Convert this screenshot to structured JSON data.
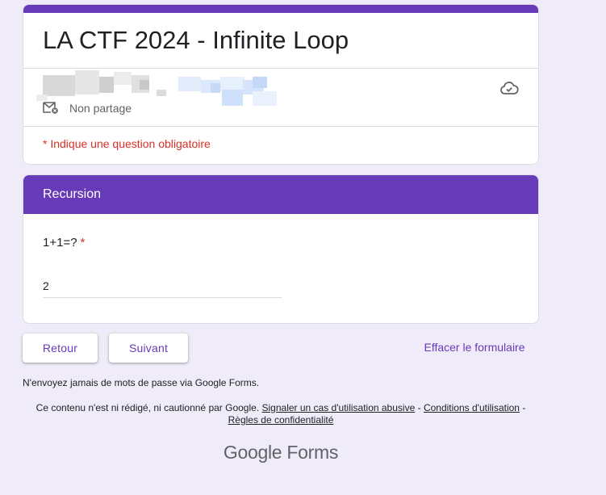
{
  "form": {
    "title": "LA CTF 2024 - Infinite Loop",
    "share_status": "Non partage",
    "required_note": "* Indique une question obligatoire"
  },
  "section": {
    "title": "Recursion",
    "question": {
      "label": "1+1=?",
      "required_mark": "*",
      "answer_value": "2"
    }
  },
  "buttons": {
    "back": "Retour",
    "next": "Suivant",
    "clear": "Effacer le formulaire"
  },
  "footer": {
    "password_warning": "N'envoyez jamais de mots de passe via Google Forms.",
    "disclaimer_prefix": "Ce contenu n'est ni rédigé, ni cautionné par Google.",
    "abuse_link": "Signaler un cas d'utilisation abusive",
    "separator": "-",
    "terms_link": "Conditions d'utilisation",
    "privacy_link": "Règles de confidentialité",
    "logo_google": "Google",
    "logo_forms": "Forms"
  },
  "icons": {
    "share": "mail-shared-icon",
    "cloud": "cloud-saved-icon"
  },
  "colors": {
    "accent": "#673ab7",
    "background": "#f0ebf8",
    "required": "#d93025"
  }
}
